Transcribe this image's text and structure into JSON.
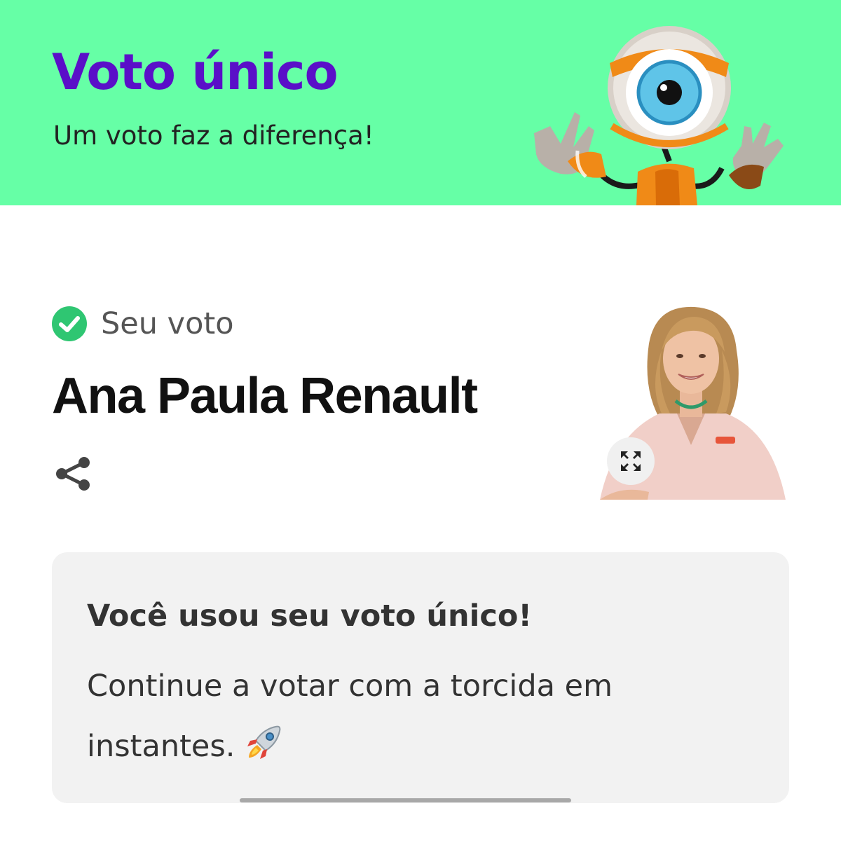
{
  "header": {
    "title": "Voto único",
    "subtitle": "Um voto faz a diferença!",
    "background_color": "#66ffa6",
    "title_color": "#5a0fc8",
    "mascot_icon": "big-brother-eye-robot-mascot"
  },
  "vote": {
    "status_label": "Seu voto",
    "status_icon": "check-circle-icon",
    "status_color": "#2fc672",
    "candidate_name": "Ana Paula Renault",
    "share_icon": "share-icon",
    "expand_icon": "expand-icon"
  },
  "notice": {
    "title": "Você usou seu voto único!",
    "body": "Continue a votar com a torcida em instantes.",
    "icon": "rocket-icon"
  }
}
